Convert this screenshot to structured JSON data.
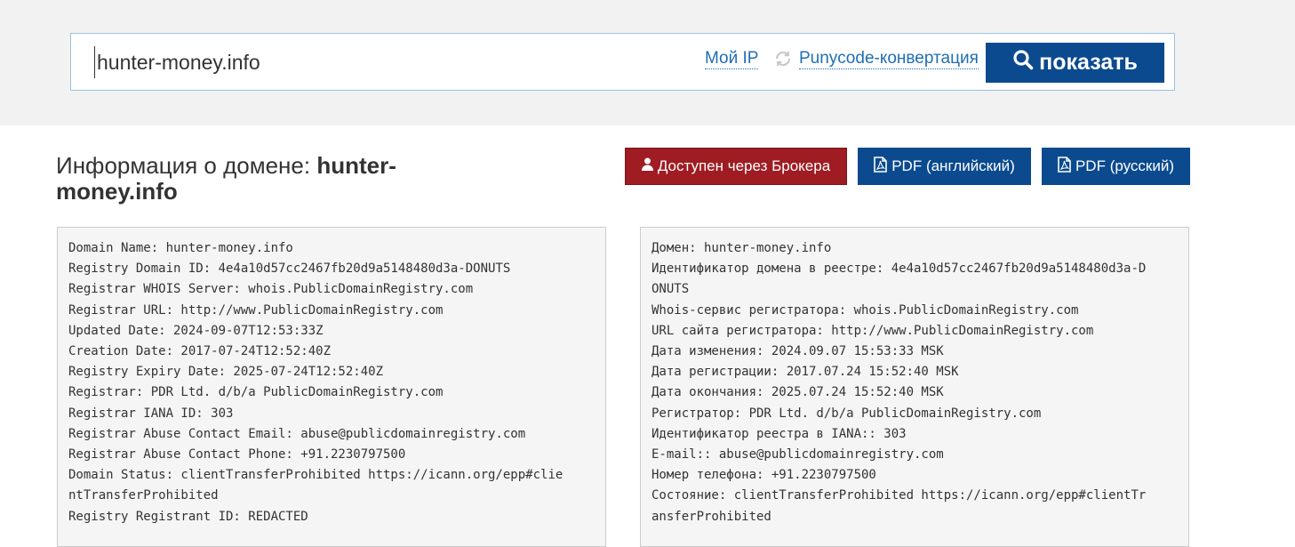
{
  "search": {
    "value": "hunter-money.info",
    "my_ip_label": "Мой IP",
    "punycode_label": "Punycode-конвертация",
    "show_label": "показать",
    "search_icon": "search-icon",
    "refresh_icon": "refresh-icon"
  },
  "header": {
    "title_prefix": "Информация о домене: ",
    "title_domain": "hunter-money.info"
  },
  "actions": {
    "broker_label": "Доступен через Брокера",
    "pdf_en_label": "PDF (английский)",
    "pdf_ru_label": "PDF (русский)",
    "user_icon": "user-icon",
    "pdf_icon": "file-pdf-icon"
  },
  "whois_en": [
    "Domain Name: hunter-money.info",
    "Registry Domain ID: 4e4a10d57cc2467fb20d9a5148480d3a-DONUTS",
    "Registrar WHOIS Server: whois.PublicDomainRegistry.com",
    "Registrar URL: http://www.PublicDomainRegistry.com",
    "Updated Date: 2024-09-07T12:53:33Z",
    "Creation Date: 2017-07-24T12:52:40Z",
    "Registry Expiry Date: 2025-07-24T12:52:40Z",
    "Registrar: PDR Ltd. d/b/a PublicDomainRegistry.com",
    "Registrar IANA ID: 303",
    "Registrar Abuse Contact Email: abuse@publicdomainregistry.com",
    "Registrar Abuse Contact Phone: +91.2230797500",
    "Domain Status: clientTransferProhibited https://icann.org/epp#clie",
    "ntTransferProhibited",
    "Registry Registrant ID: REDACTED"
  ],
  "whois_ru": [
    "Домен: hunter-money.info",
    "Идентификатор домена в реестре: 4e4a10d57cc2467fb20d9a5148480d3a-D",
    "ONUTS",
    "Whois-сервис регистратора: whois.PublicDomainRegistry.com",
    "URL сайта регистратора: http://www.PublicDomainRegistry.com",
    "Дата изменения: 2024.09.07 15:53:33 MSK",
    "Дата регистрации: 2017.07.24 15:52:40 MSK",
    "Дата окончания: 2025.07.24 15:52:40 MSK",
    "Регистратор: PDR Ltd. d/b/a PublicDomainRegistry.com",
    "Идентификатор реестра в IANA:: 303",
    "E-mail:: abuse@publicdomainregistry.com",
    "Номер телефона: +91.2230797500",
    "Состояние: clientTransferProhibited https://icann.org/epp#clientTr",
    "ansferProhibited"
  ]
}
